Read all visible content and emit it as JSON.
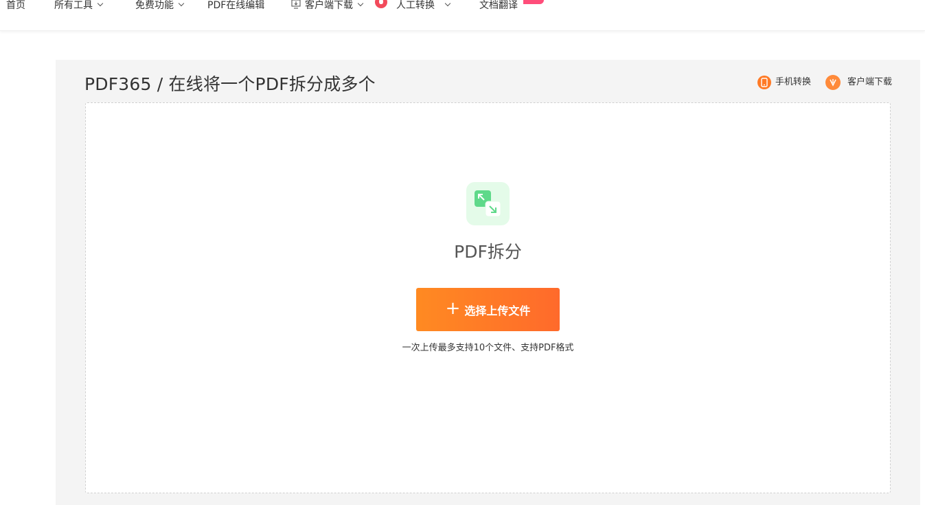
{
  "nav": {
    "home": "首页",
    "all_tools": "所有工具",
    "free_features": "免费功能",
    "pdf_edit": "PDF在线编辑",
    "client_download": "客户端下载",
    "manual_convert": "人工转换",
    "doc_translate": "文档翻译"
  },
  "header": {
    "title": "PDF365 / 在线将一个PDF拆分成多个",
    "mobile_convert": "手机转换",
    "client_download": "客户端下载"
  },
  "upload": {
    "tool_name": "PDF拆分",
    "button_label": "选择上传文件",
    "plus": "+",
    "hint": "一次上传最多支持10个文件、支持PDF格式"
  },
  "colors": {
    "accent_orange": "#ff7a26",
    "icon_green": "#5fd98a",
    "badge_pink": "#ff4d7a"
  }
}
